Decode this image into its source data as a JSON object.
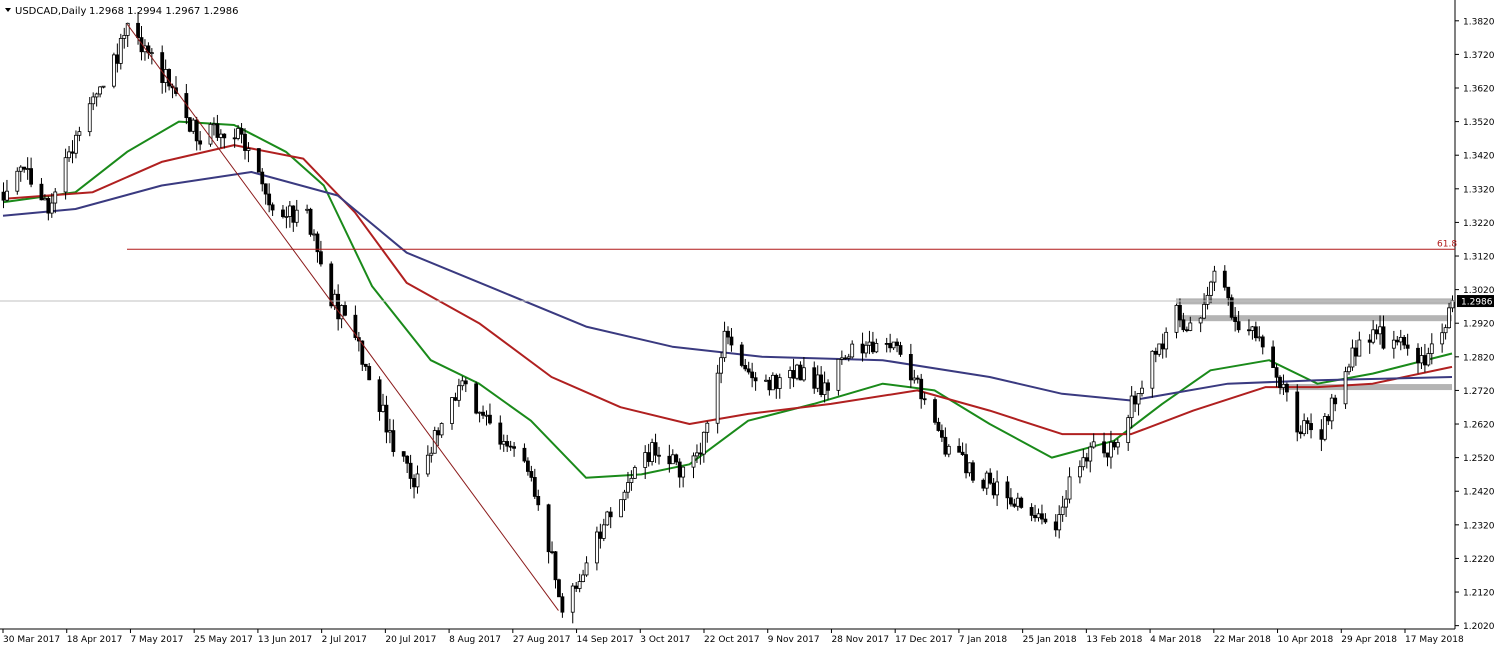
{
  "header": {
    "symbol_label": "USDCAD,Daily",
    "ohlc_values": "1.2968 1.2994 1.2967 1.2986"
  },
  "colors": {
    "candle": "#000000",
    "ma_green": "#1a8a1a",
    "ma_red": "#b02020",
    "ma_navy": "#3a3a80",
    "fib_line": "#b01818",
    "trend_line": "#8b1a1a",
    "zone_gray": "#b4b4b4",
    "price_line": "#c0c0c0",
    "price_badge_bg": "#000000",
    "price_badge_text": "#ffffff"
  },
  "chart_data": {
    "type": "candlestick",
    "title": "USDCAD,Daily",
    "ylim": [
      1.201,
      1.387
    ],
    "y_ticks": [
      "1.3820",
      "1.3720",
      "1.3620",
      "1.3520",
      "1.3420",
      "1.3320",
      "1.3220",
      "1.3120",
      "1.3020",
      "1.2920",
      "1.2820",
      "1.2720",
      "1.2620",
      "1.2520",
      "1.2420",
      "1.2320",
      "1.2220",
      "1.2120",
      "1.2020"
    ],
    "x_labels": [
      "30 Mar 2017",
      "18 Apr 2017",
      "7 May 2017",
      "25 May 2017",
      "13 Jun 2017",
      "2 Jul 2017",
      "20 Jul 2017",
      "8 Aug 2017",
      "27 Aug 2017",
      "14 Sep 2017",
      "3 Oct 2017",
      "22 Oct 2017",
      "9 Nov 2017",
      "28 Nov 2017",
      "17 Dec 2017",
      "7 Jan 2018",
      "25 Jan 2018",
      "13 Feb 2018",
      "4 Mar 2018",
      "22 Mar 2018",
      "10 Apr 2018",
      "29 Apr 2018",
      "17 May 2018"
    ],
    "x_range": [
      "2017-03-30",
      "2018-05-24"
    ],
    "close_path": [
      [
        "2017-03-30",
        1.331
      ],
      [
        "2017-04-05",
        1.338
      ],
      [
        "2017-04-12",
        1.326
      ],
      [
        "2017-04-18",
        1.342
      ],
      [
        "2017-04-24",
        1.356
      ],
      [
        "2017-05-01",
        1.37
      ],
      [
        "2017-05-05",
        1.379
      ],
      [
        "2017-05-10",
        1.372
      ],
      [
        "2017-05-16",
        1.365
      ],
      [
        "2017-05-20",
        1.356
      ],
      [
        "2017-05-25",
        1.348
      ],
      [
        "2017-06-01",
        1.35
      ],
      [
        "2017-06-07",
        1.348
      ],
      [
        "2017-06-13",
        1.333
      ],
      [
        "2017-06-19",
        1.323
      ],
      [
        "2017-06-25",
        1.327
      ],
      [
        "2017-07-02",
        1.301
      ],
      [
        "2017-07-10",
        1.288
      ],
      [
        "2017-07-16",
        1.27
      ],
      [
        "2017-07-22",
        1.254
      ],
      [
        "2017-07-27",
        1.245
      ],
      [
        "2017-08-03",
        1.26
      ],
      [
        "2017-08-10",
        1.274
      ],
      [
        "2017-08-17",
        1.262
      ],
      [
        "2017-08-24",
        1.256
      ],
      [
        "2017-08-31",
        1.242
      ],
      [
        "2017-09-08",
        1.209
      ],
      [
        "2017-09-14",
        1.218
      ],
      [
        "2017-09-21",
        1.235
      ],
      [
        "2017-09-28",
        1.248
      ],
      [
        "2017-10-05",
        1.255
      ],
      [
        "2017-10-12",
        1.249
      ],
      [
        "2017-10-18",
        1.256
      ],
      [
        "2017-10-25",
        1.288
      ],
      [
        "2017-11-01",
        1.276
      ],
      [
        "2017-11-09",
        1.274
      ],
      [
        "2017-11-16",
        1.278
      ],
      [
        "2017-11-23",
        1.272
      ],
      [
        "2017-11-30",
        1.284
      ],
      [
        "2017-12-07",
        1.286
      ],
      [
        "2017-12-14",
        1.287
      ],
      [
        "2017-12-21",
        1.271
      ],
      [
        "2017-12-28",
        1.256
      ],
      [
        "2018-01-04",
        1.248
      ],
      [
        "2018-01-10",
        1.244
      ],
      [
        "2018-01-16",
        1.24
      ],
      [
        "2018-01-22",
        1.235
      ],
      [
        "2018-01-28",
        1.228
      ],
      [
        "2018-02-03",
        1.249
      ],
      [
        "2018-02-09",
        1.256
      ],
      [
        "2018-02-15",
        1.254
      ],
      [
        "2018-02-21",
        1.27
      ],
      [
        "2018-02-27",
        1.283
      ],
      [
        "2018-03-05",
        1.295
      ],
      [
        "2018-03-11",
        1.289
      ],
      [
        "2018-03-16",
        1.308
      ],
      [
        "2018-03-22",
        1.292
      ],
      [
        "2018-03-28",
        1.288
      ],
      [
        "2018-04-03",
        1.277
      ],
      [
        "2018-04-09",
        1.262
      ],
      [
        "2018-04-15",
        1.258
      ],
      [
        "2018-04-21",
        1.272
      ],
      [
        "2018-04-27",
        1.287
      ],
      [
        "2018-05-03",
        1.288
      ],
      [
        "2018-05-09",
        1.285
      ],
      [
        "2018-05-15",
        1.28
      ],
      [
        "2018-05-20",
        1.288
      ],
      [
        "2018-05-24",
        1.2986
      ]
    ],
    "moving_averages": [
      {
        "color_key": "ma_green",
        "points": [
          [
            "2017-03-30",
            1.328
          ],
          [
            "2017-04-20",
            1.331
          ],
          [
            "2017-05-05",
            1.343
          ],
          [
            "2017-05-20",
            1.352
          ],
          [
            "2017-06-05",
            1.351
          ],
          [
            "2017-06-20",
            1.343
          ],
          [
            "2017-07-01",
            1.333
          ],
          [
            "2017-07-15",
            1.303
          ],
          [
            "2017-08-01",
            1.281
          ],
          [
            "2017-08-15",
            1.274
          ],
          [
            "2017-08-30",
            1.263
          ],
          [
            "2017-09-15",
            1.246
          ],
          [
            "2017-10-01",
            1.247
          ],
          [
            "2017-10-15",
            1.25
          ],
          [
            "2017-11-01",
            1.263
          ],
          [
            "2017-11-20",
            1.268
          ],
          [
            "2017-12-10",
            1.274
          ],
          [
            "2017-12-25",
            1.272
          ],
          [
            "2018-01-10",
            1.262
          ],
          [
            "2018-01-28",
            1.252
          ],
          [
            "2018-02-15",
            1.257
          ],
          [
            "2018-03-01",
            1.268
          ],
          [
            "2018-03-15",
            1.278
          ],
          [
            "2018-04-01",
            1.281
          ],
          [
            "2018-04-15",
            1.274
          ],
          [
            "2018-05-01",
            1.277
          ],
          [
            "2018-05-24",
            1.283
          ]
        ]
      },
      {
        "color_key": "ma_red",
        "points": [
          [
            "2017-03-30",
            1.329
          ],
          [
            "2017-04-25",
            1.331
          ],
          [
            "2017-05-15",
            1.34
          ],
          [
            "2017-06-05",
            1.345
          ],
          [
            "2017-06-25",
            1.341
          ],
          [
            "2017-07-10",
            1.325
          ],
          [
            "2017-07-25",
            1.304
          ],
          [
            "2017-08-15",
            1.292
          ],
          [
            "2017-09-05",
            1.276
          ],
          [
            "2017-09-25",
            1.267
          ],
          [
            "2017-10-15",
            1.262
          ],
          [
            "2017-11-01",
            1.265
          ],
          [
            "2017-11-25",
            1.268
          ],
          [
            "2017-12-20",
            1.272
          ],
          [
            "2018-01-10",
            1.266
          ],
          [
            "2018-01-31",
            1.259
          ],
          [
            "2018-02-20",
            1.259
          ],
          [
            "2018-03-10",
            1.266
          ],
          [
            "2018-03-31",
            1.273
          ],
          [
            "2018-04-15",
            1.273
          ],
          [
            "2018-05-01",
            1.274
          ],
          [
            "2018-05-24",
            1.279
          ]
        ]
      },
      {
        "color_key": "ma_navy",
        "points": [
          [
            "2017-03-30",
            1.324
          ],
          [
            "2017-04-20",
            1.326
          ],
          [
            "2017-05-15",
            1.333
          ],
          [
            "2017-06-10",
            1.337
          ],
          [
            "2017-07-05",
            1.33
          ],
          [
            "2017-07-25",
            1.313
          ],
          [
            "2017-08-20",
            1.302
          ],
          [
            "2017-09-15",
            1.291
          ],
          [
            "2017-10-10",
            1.285
          ],
          [
            "2017-11-05",
            1.282
          ],
          [
            "2017-12-10",
            1.281
          ],
          [
            "2018-01-10",
            1.276
          ],
          [
            "2018-01-31",
            1.271
          ],
          [
            "2018-02-20",
            1.269
          ],
          [
            "2018-03-20",
            1.274
          ],
          [
            "2018-04-15",
            1.275
          ],
          [
            "2018-05-24",
            1.276
          ]
        ]
      }
    ],
    "fib_level": {
      "label": "61.8",
      "price": 1.314
    },
    "trend_line": {
      "from": [
        "2017-05-05",
        1.381
      ],
      "to": [
        "2017-09-07",
        1.2065
      ]
    },
    "zones": [
      {
        "from": "2018-03-05",
        "to": "2018-05-24",
        "price": 1.2985
      },
      {
        "from": "2018-03-05",
        "to": "2018-05-24",
        "price": 1.2935
      },
      {
        "from": "2018-04-04",
        "to": "2018-05-24",
        "price": 1.273
      }
    ],
    "current_price": "1.2986",
    "grid": false,
    "legend": "none"
  }
}
